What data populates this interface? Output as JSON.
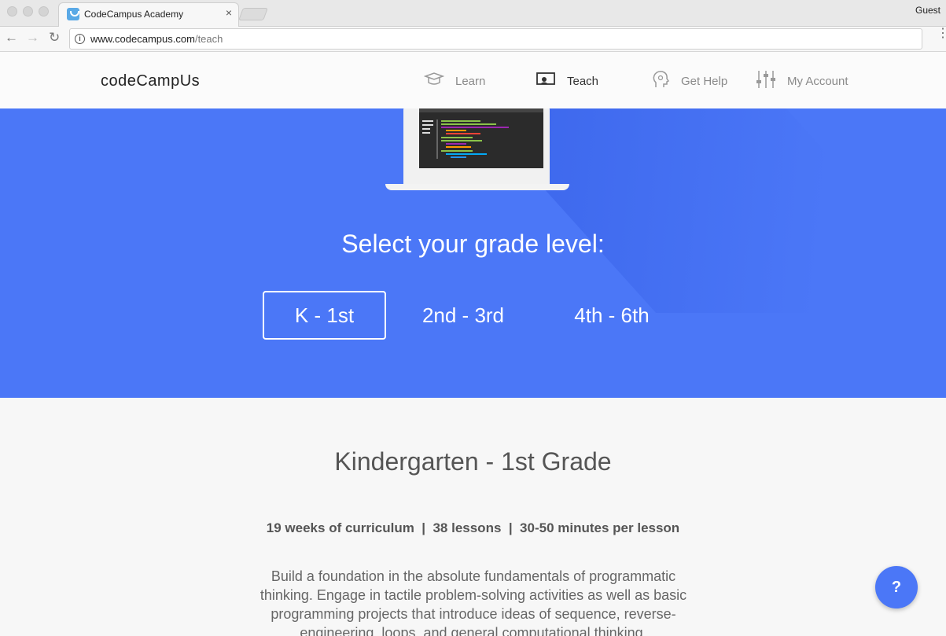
{
  "browser": {
    "tab_title": "CodeCampus Academy",
    "tab_close": "×",
    "profile": "Guest",
    "url_host": "www.codecampus.com",
    "url_path": "/teach",
    "back_glyph": "←",
    "forward_glyph": "→",
    "reload_glyph": "↻",
    "info_glyph": "i",
    "menu_glyph": "⋮"
  },
  "header": {
    "logo": "codeCampUs",
    "nav": [
      {
        "label": "Learn",
        "icon": "graduation-cap-icon"
      },
      {
        "label": "Teach",
        "icon": "presentation-screen-icon",
        "active": true
      },
      {
        "label": "Get Help",
        "icon": "head-icon"
      },
      {
        "label": "My Account",
        "icon": "sliders-icon"
      }
    ]
  },
  "hero": {
    "title": "Select your grade level:",
    "grades": [
      {
        "label": "K - 1st",
        "selected": true
      },
      {
        "label": "2nd - 3rd",
        "selected": false
      },
      {
        "label": "4th - 6th",
        "selected": false
      }
    ]
  },
  "content": {
    "title": "Kindergarten - 1st Grade",
    "stats": "19 weeks of curriculum  |  38 lessons  |  30-50 minutes per lesson",
    "description": "Build a foundation in the absolute fundamentals of programmatic thinking. Engage in tactile problem-solving activities as well as basic programming projects that introduce ideas of sequence, reverse-engineering, loops, and general computational thinking."
  },
  "help_button": "?",
  "colors": {
    "accent": "#4b77f7",
    "hero_background": "#4b77f7",
    "text_dark": "#555555"
  }
}
